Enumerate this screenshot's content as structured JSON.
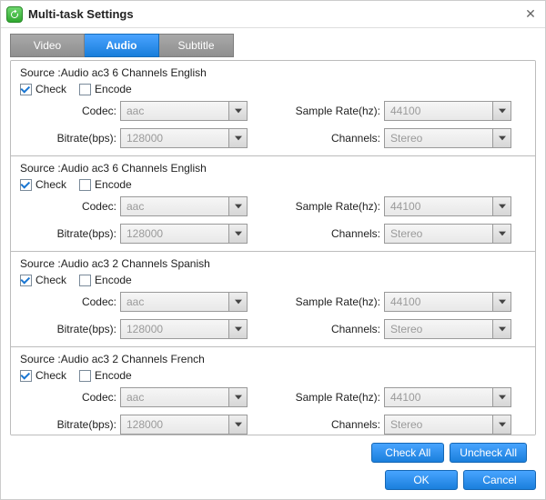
{
  "window": {
    "title": "Multi-task Settings"
  },
  "tabs": {
    "video": "Video",
    "audio": "Audio",
    "subtitle": "Subtitle",
    "active": "audio"
  },
  "labels": {
    "source_prefix": "Source :",
    "check": "Check",
    "encode": "Encode",
    "codec": "Codec:",
    "sample_rate": "Sample Rate(hz):",
    "bitrate": "Bitrate(bps):",
    "channels": "Channels:"
  },
  "tracks": [
    {
      "source": "Audio  ac3  6 Channels  English",
      "checked": true,
      "encode": false,
      "codec": "aac",
      "sample_rate": "44100",
      "bitrate": "128000",
      "channels": "Stereo"
    },
    {
      "source": "Audio  ac3  6 Channels  English",
      "checked": true,
      "encode": false,
      "codec": "aac",
      "sample_rate": "44100",
      "bitrate": "128000",
      "channels": "Stereo"
    },
    {
      "source": "Audio  ac3  2 Channels  Spanish",
      "checked": true,
      "encode": false,
      "codec": "aac",
      "sample_rate": "44100",
      "bitrate": "128000",
      "channels": "Stereo"
    },
    {
      "source": "Audio  ac3  2 Channels  French",
      "checked": true,
      "encode": false,
      "codec": "aac",
      "sample_rate": "44100",
      "bitrate": "128000",
      "channels": "Stereo"
    }
  ],
  "buttons": {
    "check_all": "Check All",
    "uncheck_all": "Uncheck All",
    "ok": "OK",
    "cancel": "Cancel"
  }
}
